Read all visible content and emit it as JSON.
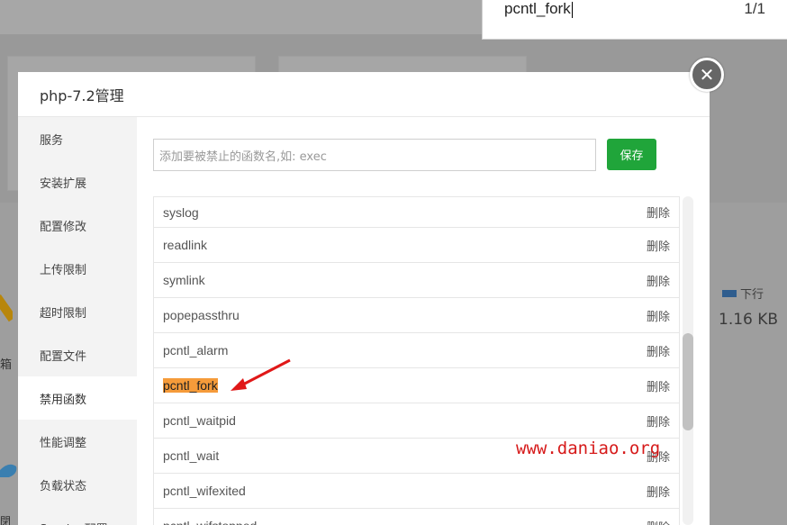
{
  "find_bar": {
    "query": "pcntl_fork",
    "count": "1/1"
  },
  "background": {
    "legend_label": "下行",
    "value": "1.16 KB",
    "edge_text": "箱",
    "edge_text2": "閉"
  },
  "modal": {
    "title": "php-7.2管理",
    "close_glyph": "✕",
    "sidebar": [
      "服务",
      "安装扩展",
      "配置修改",
      "上传限制",
      "超时限制",
      "配置文件",
      "禁用函数",
      "性能调整",
      "负载状态",
      "Session配置"
    ],
    "active_item": "禁用函数",
    "input_placeholder": "添加要被禁止的函数名,如: exec",
    "save_label": "保存",
    "delete_label": "删除",
    "functions": [
      "syslog",
      "readlink",
      "symlink",
      "popepassthru",
      "pcntl_alarm",
      "pcntl_fork",
      "pcntl_waitpid",
      "pcntl_wait",
      "pcntl_wifexited",
      "pcntl_wifstopped"
    ],
    "highlighted_function": "pcntl_fork"
  },
  "watermark": "www.daniao.org",
  "colors": {
    "save_button": "#20a53a",
    "highlight": "#f59b3a",
    "watermark": "#d61a1a",
    "legend_square": "#2f5d8e"
  }
}
